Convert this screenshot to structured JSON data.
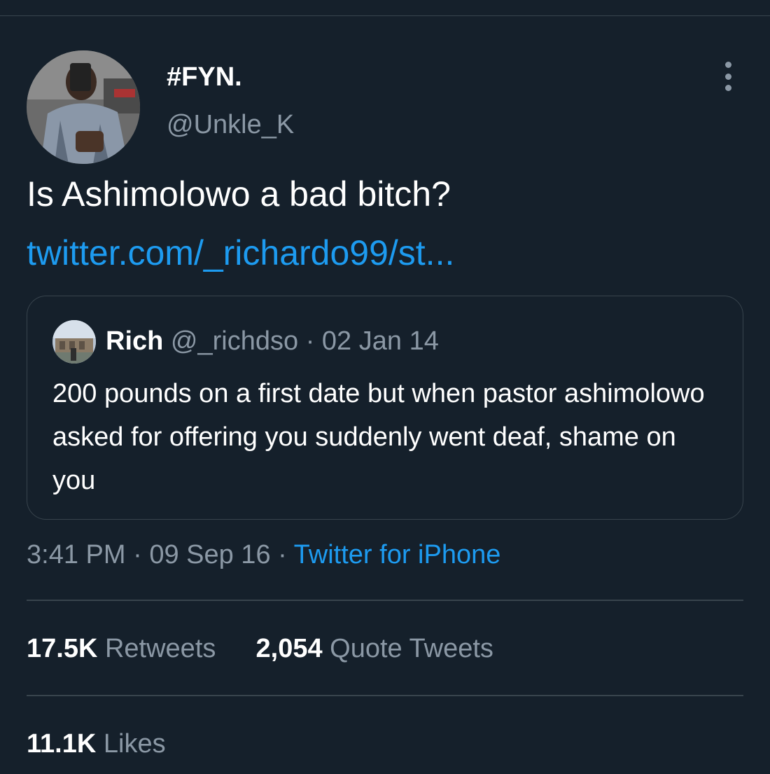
{
  "tweet": {
    "display_name": "#FYN.",
    "handle": "@Unkle_K",
    "text": "Is Ashimolowo a bad bitch?",
    "link": "twitter.com/_richardo99/st...",
    "avatar_icon": "user-avatar-photo",
    "more_icon": "more-vertical-icon"
  },
  "quoted_tweet": {
    "name": "Rich",
    "handle": "@_richdso",
    "separator": "·",
    "date": "02 Jan 14",
    "text": "200 pounds on a first date but when pastor ashimolowo asked for offering you suddenly went deaf, shame on you"
  },
  "meta": {
    "time": "3:41 PM",
    "separator": "·",
    "date": "09 Sep 16",
    "source": "Twitter for iPhone"
  },
  "stats": {
    "retweets_count": "17.5K",
    "retweets_label": "Retweets",
    "quotes_count": "2,054",
    "quotes_label": "Quote Tweets",
    "likes_count": "11.1K",
    "likes_label": "Likes"
  },
  "colors": {
    "background": "#15202b",
    "text_primary": "#ffffff",
    "text_secondary": "#8b98a5",
    "accent": "#1d9bf0",
    "border": "#38444d"
  }
}
